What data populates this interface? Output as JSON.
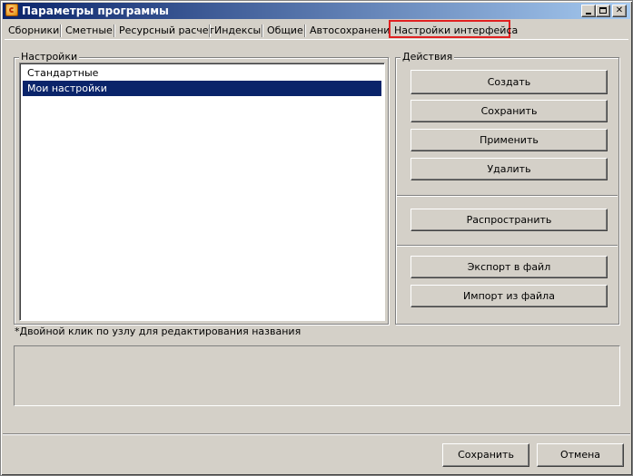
{
  "window": {
    "title": "Параметры программы",
    "icon": "app-icon"
  },
  "tabs": [
    {
      "label": "Сборники"
    },
    {
      "label": "Сметные"
    },
    {
      "label": "Ресурсный расчет"
    },
    {
      "label": "Индексы"
    },
    {
      "label": "Общие"
    },
    {
      "label": "Автосохранение"
    },
    {
      "label": "Настройки интерфейса",
      "active": true
    }
  ],
  "settings": {
    "legend": "Настройки",
    "items": [
      {
        "label": "Стандартные",
        "selected": false
      },
      {
        "label": "Мои настройки",
        "selected": true
      }
    ],
    "note": "*Двойной клик по узлу для редактирования названия"
  },
  "actions": {
    "legend": "Действия",
    "create": "Создать",
    "save": "Сохранить",
    "apply": "Применить",
    "delete": "Удалить",
    "distribute": "Распространить",
    "export": "Экспорт в файл",
    "import": "Импорт из файла"
  },
  "footer": {
    "save": "Сохранить",
    "cancel": "Отмена"
  },
  "colors": {
    "titlebar_start": "#0a246a",
    "titlebar_end": "#a6caf0",
    "selection": "#0a246a",
    "active_tab_border": "#e02020",
    "face": "#d4d0c8"
  }
}
